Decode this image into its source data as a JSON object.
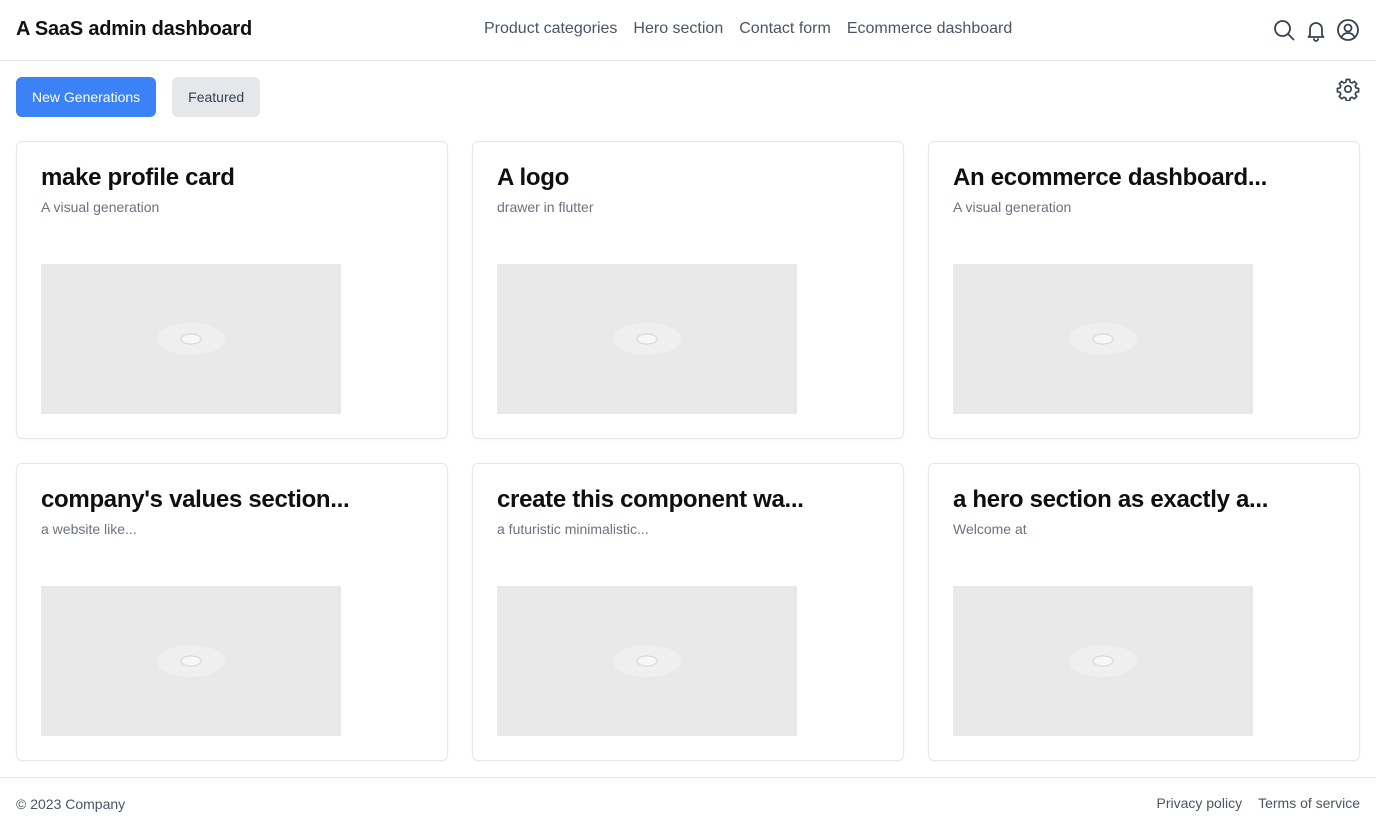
{
  "header": {
    "title": "A SaaS admin dashboard",
    "nav": [
      {
        "label": "Product categories"
      },
      {
        "label": "Hero section"
      },
      {
        "label": "Contact form"
      },
      {
        "label": "Ecommerce dashboard"
      }
    ],
    "icons": [
      "search-icon",
      "bell-icon",
      "user-circle-icon"
    ]
  },
  "toolbar": {
    "new_generations_label": "New Generations",
    "featured_label": "Featured",
    "settings_icon": "gear-icon"
  },
  "colors": {
    "accent": "#3b82f6",
    "secondary_button": "#e5e7eb",
    "thumbnail_placeholder": "#e9e9e9"
  },
  "cards": [
    {
      "title": "make profile card",
      "subtitle": "A visual generation",
      "thumbnail_icon": "image-placeholder-icon"
    },
    {
      "title": "A logo",
      "subtitle": "drawer in flutter",
      "thumbnail_icon": "image-placeholder-icon"
    },
    {
      "title": "An ecommerce dashboard...",
      "subtitle": "A visual generation",
      "thumbnail_icon": "image-placeholder-icon"
    },
    {
      "title": "company's values section...",
      "subtitle": "a website like...",
      "thumbnail_icon": "image-placeholder-icon"
    },
    {
      "title": "create this component wa...",
      "subtitle": "a futuristic minimalistic...",
      "thumbnail_icon": "image-placeholder-icon"
    },
    {
      "title": "a hero section as exactly a...",
      "subtitle": "Welcome at",
      "thumbnail_icon": "image-placeholder-icon"
    }
  ],
  "footer": {
    "copyright": "© 2023 Company",
    "links": [
      {
        "label": "Privacy policy"
      },
      {
        "label": "Terms of service"
      }
    ]
  }
}
